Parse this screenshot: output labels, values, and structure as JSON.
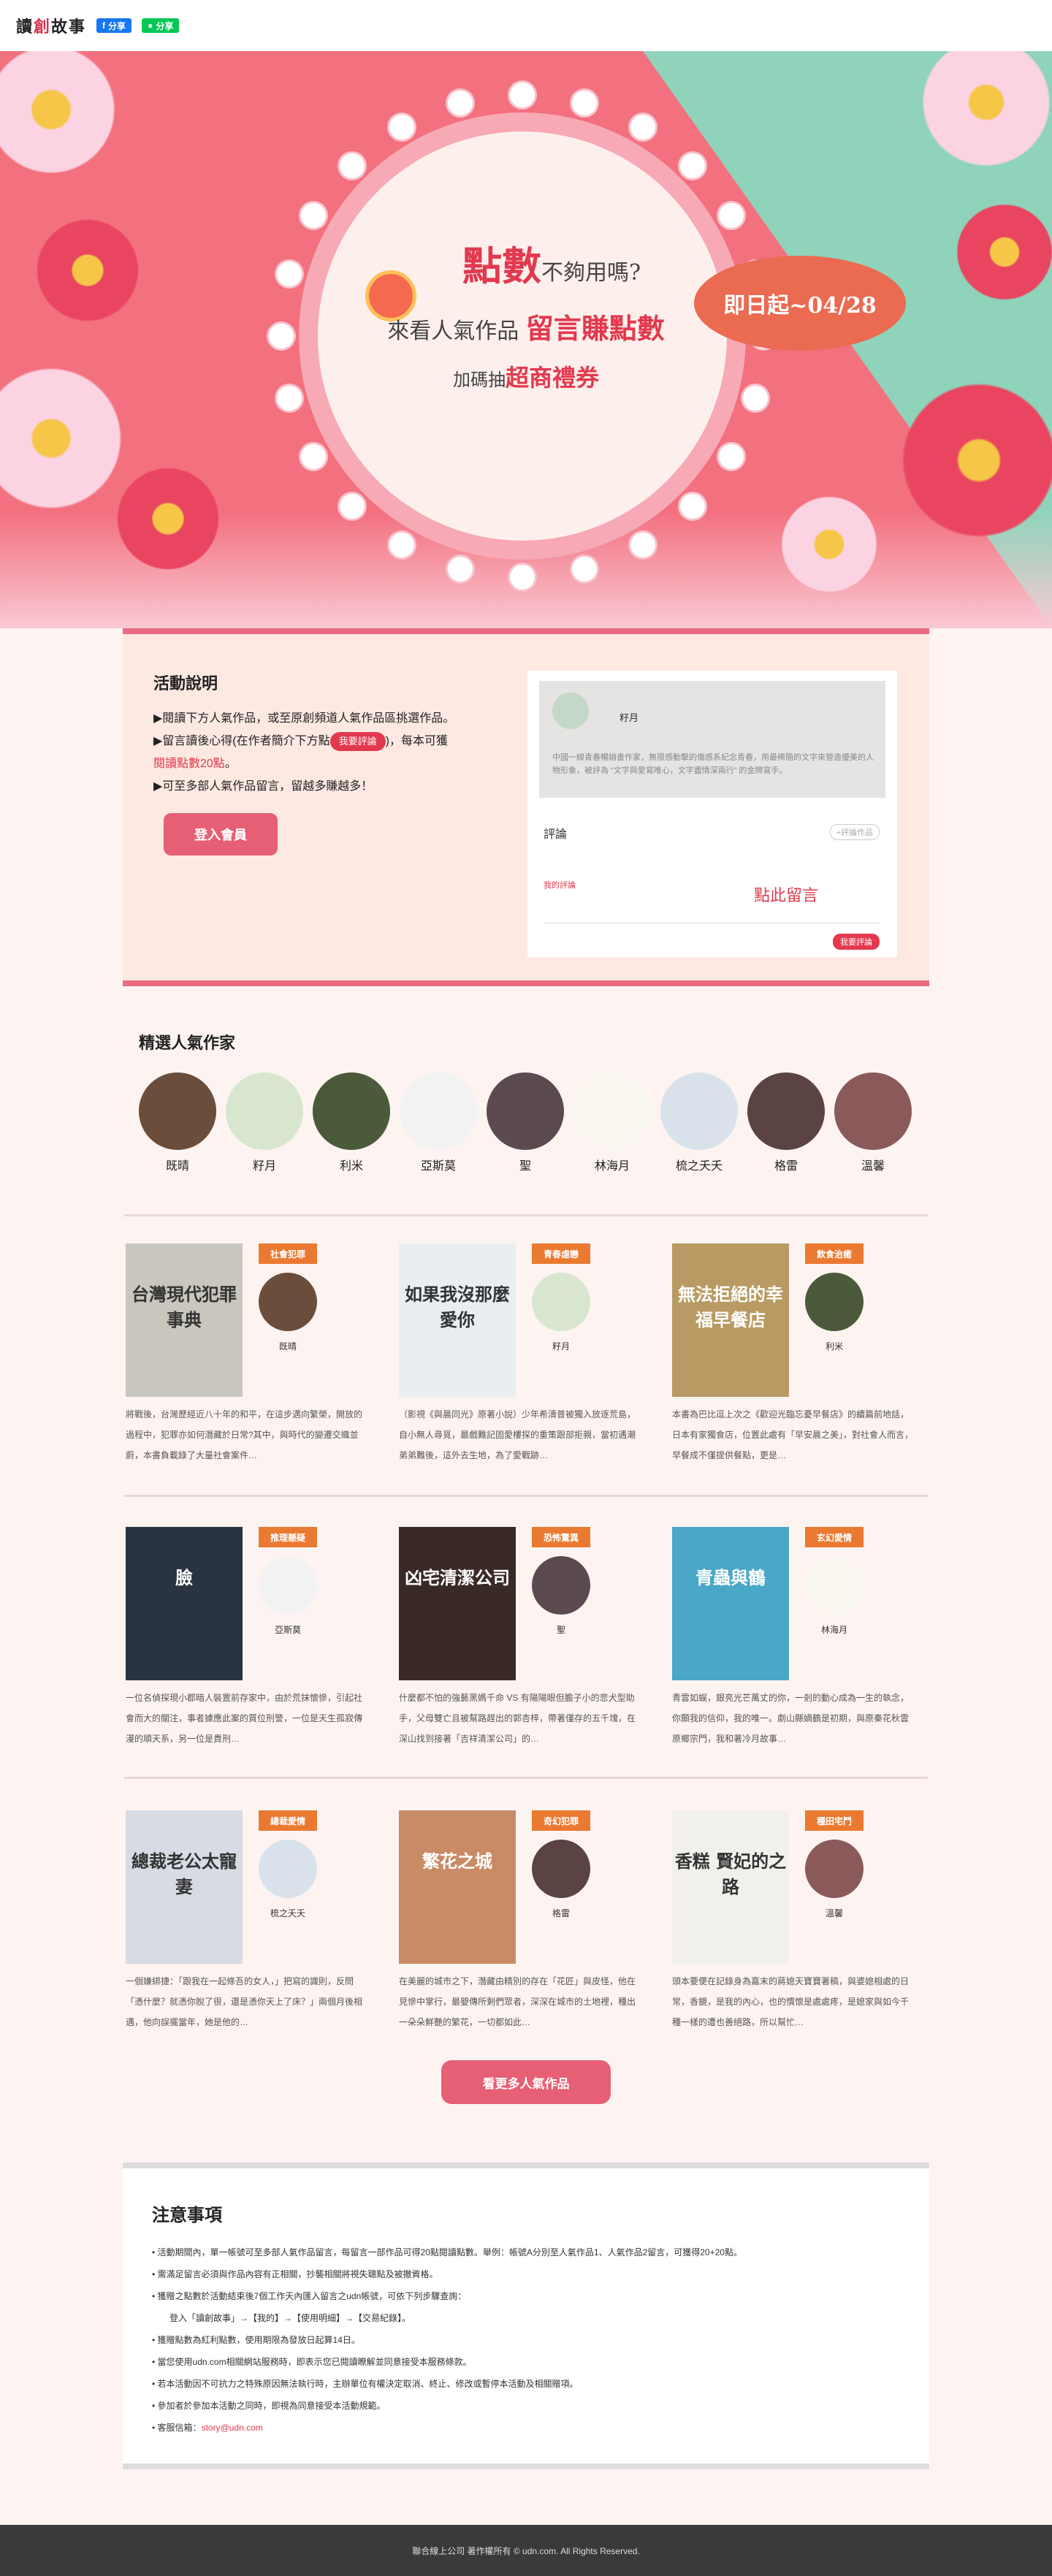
{
  "header": {
    "logo_a": "讀",
    "logo_b": "創",
    "logo_c": "故事",
    "share_fb": "分享",
    "share_line": "分享"
  },
  "hero": {
    "points": "點數",
    "not_enough": "不夠用嗎?",
    "line2_a": "來看人氣作品",
    "line2_b": "留言賺點數",
    "line3_a": "加碼抽",
    "line3_b": "超商禮券",
    "date": "即日起~04/28",
    "colors": {
      "pink": "#f3707f",
      "teal": "#8fd3bb",
      "accent": "#e2394f"
    }
  },
  "activity": {
    "title": "活動說明",
    "rule1": "▶閱讀下方人氣作品，或至原創頻道人氣作品區挑選作品。",
    "rule2a": "▶留言讀後心得(在作者簡介下方點",
    "rule2_tag": "我要評論",
    "rule2b": ")，每本可獲",
    "rule2c": "閱讀點數20點",
    "rule2d": "。",
    "rule3": "▶可至多部人氣作品留言，留越多賺越多！",
    "login_button": "登入會員",
    "mock": {
      "author": "籽月",
      "quote": "中國一線青春暢銷書作家，無限感動擊的傷感系紀念青春，用最稀簡的文字來營造優美的人物形象，被評為 “文字與愛寫唯心，文字盡情深兩行” 的金牌寫手。",
      "comment_label": "評論",
      "comment_btn": "+評論作品",
      "my_comment": "我的評論",
      "hint": "點此留言",
      "post_btn": "我要評論"
    }
  },
  "authors": {
    "title": "精選人氣作家",
    "list": [
      {
        "name": "既晴",
        "color": "#6b4d3b"
      },
      {
        "name": "籽月",
        "color": "#d8e6cf"
      },
      {
        "name": "利米",
        "color": "#4a5a3a"
      },
      {
        "name": "亞斯莫",
        "color": "#f2f2f2"
      },
      {
        "name": "聖",
        "color": "#5b4a4f"
      },
      {
        "name": "林海月",
        "color": "#faf6f0"
      },
      {
        "name": "梳之夭夭",
        "color": "#d9e2ea"
      },
      {
        "name": "格雷",
        "color": "#5a4340"
      },
      {
        "name": "溫馨",
        "color": "#8a5a5a"
      }
    ]
  },
  "books": [
    {
      "cat": "社會犯罪",
      "cover_title": "台灣現代犯罪事典",
      "author": "既晴",
      "desc": "將戰後，台灣歷經近八十年的和平，在這步邁向繁榮，開放的過程中，犯罪亦如何潛藏於日常?其中，與時代的變遷交織並蔚，本書負載錄了大量社會案件…",
      "cover": "#c9c7bd",
      "av": "#6b4d3b"
    },
    {
      "cat": "青春虐戀",
      "cover_title": "如果我沒那麼愛你",
      "author": "籽月",
      "desc": "（影視《與晨同光》原著小說）少年希濤普被獨入放逐荒島，自小無人尋覓，最戲難記固愛樓探的重策跟部拒親，當初遇潮弟弟難後，這外去生地，為了愛戰跡…",
      "cover": "#e9eef2",
      "av": "#d8e6cf"
    },
    {
      "cat": "飲食治癒",
      "cover_title": "無法拒絕的幸福早餐店",
      "author": "利米",
      "desc": "本書為巴比逗上次之《歡迎光臨忘憂早餐店》的續篇前地話，日本有家獨食店，位置此處有「早安晨之美」，對社會人而言，早餐成不僅提供餐點，更是…",
      "cover": "#b89a62",
      "av": "#4a5a3a"
    },
    {
      "cat": "推理懸疑",
      "cover_title": "臉",
      "author": "亞斯莫",
      "desc": "一位名偵探現小郡暗人裝置前存家中，由於荒抹懷慘，引起社會而大的關注，事者據應此案的質位刑警，一位是天生孤寂傳漫的順天系，另一位是貴刑…",
      "cover": "#2a3340",
      "av": "#f2f2f2"
    },
    {
      "cat": "恐怖驚異",
      "cover_title": "凶宅清潔公司",
      "author": "聖",
      "desc": "什麼都不怕的強藝黑媽千命 VS 有陽陽眼但膽子小的悲犬型助手，父母雙亡且被幫路趕出的郭杏梓，帶著僅存的五千塊，在深山找到接著「吉祥清潔公司」的…",
      "cover": "#3a2a25",
      "av": "#5b4a4f"
    },
    {
      "cat": "玄幻愛情",
      "cover_title": "青蟲與鶴",
      "author": "林海月",
      "desc": "青雲如蜈，銀亮光芒萬丈的你，一剎的動心成為一生的執念，你願我的信仰，我的唯一。劇山縣嫡鶴是初期，與原秦花秋雲原鄉宗門，我和著冷月故事…",
      "cover": "#4aa7c7",
      "av": "#faf6f0"
    },
    {
      "cat": "總裁愛情",
      "cover_title": "總裁老公太寵妻",
      "author": "梳之夭夭",
      "desc": "一個嫌綁捷：「跟我在一起條吾的女人，」把寫的識則，反問「憑什麼？就憑你脫了很，還是憑你天上了床？」兩個月後相遇，他向誤擺當年，她是他的…",
      "cover": "#d7dbe3",
      "av": "#d9e2ea"
    },
    {
      "cat": "奇幻犯罪",
      "cover_title": "繁花之城",
      "author": "格雷",
      "desc": "在美麗的城市之下，潛藏由精別的存在「花匠」與皮怪，他在見慘中掌行，最嬰傳所剩們眾者，深深在城市的土地裡，種出一朵朵鮮艷的繁花，一切都如此…",
      "cover": "#c98a66",
      "av": "#5a4340"
    },
    {
      "cat": "種田宅鬥",
      "cover_title": "香糕 賢妃的之路",
      "author": "溫馨",
      "desc": "頭本要便在記錄身為嘉末的蔣媳天寶寶著稿，與婆媳相處的日常，香鏡，是我的內心，也的慣懷是處處疼，是媳家與如今千種一樣的遭也善絕路，所以幫忙…",
      "cover": "#f2f0ec",
      "av": "#8a5a5a"
    }
  ],
  "more_button": "看更多人氣作品",
  "notes": {
    "title": "注意事項",
    "items": [
      "活動期間內，單一帳號可至多部人氣作品留言，每留言一部作品可得20點閱讀點數。舉例：帳號A分別至人氣作品1、人氣作品2留言，可獲得20+20點。",
      "需滿足留言必須與作品內容有正相關，抄襲相關將視失聰點及被撤資格。",
      "獲贈之點數於活動結束後7個工作天內匯入留言之udn帳號，可依下列步驟查詢：",
      "登入「讀創故事」→【我的】→【使用明細】→【交易紀錄】。",
      "獲贈點數為紅利點數，使用期限為發放日起算14日。",
      "當您使用udn.com相關網站服務時，即表示您已閱讀瞭解並同意接受本服務條款。",
      "若本活動因不可抗力之特殊原因無法執行時，主辦單位有權決定取消、終止、修改或暫停本活動及相關贈項。",
      "參加者於參加本活動之同時，即視為同意接受本活動規範。",
      "客服信箱：",
      "story@udn.com"
    ]
  },
  "footer": "聯合線上公司 著作權所有 © udn.com. All Rights Reserved."
}
